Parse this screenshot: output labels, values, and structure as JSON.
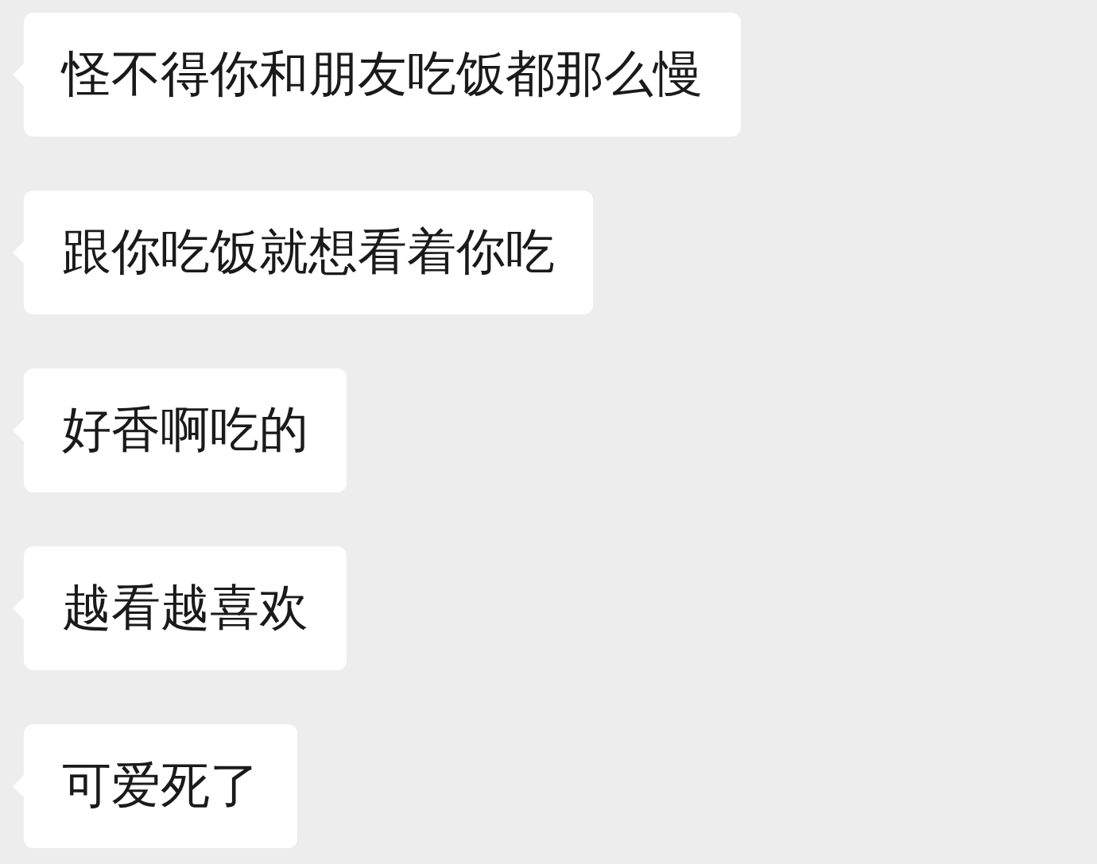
{
  "messages": [
    {
      "text": "怪不得你和朋友吃饭都那么慢"
    },
    {
      "text": "跟你吃饭就想看着你吃"
    },
    {
      "text": "好香啊吃的"
    },
    {
      "text": "越看越喜欢"
    },
    {
      "text": "可爱死了"
    }
  ]
}
